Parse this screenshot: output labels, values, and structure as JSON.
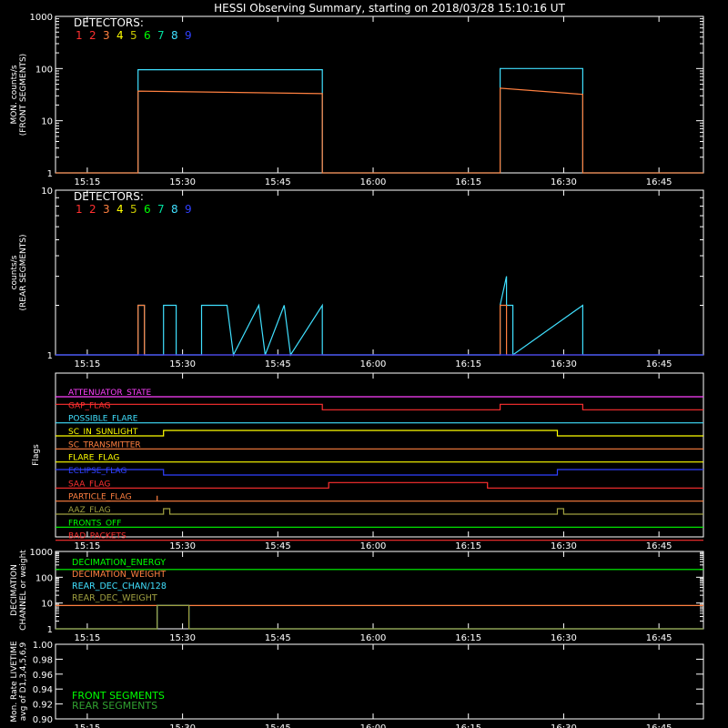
{
  "title": "HESSI Observing Summary, starting on 2018/03/28 15:10:16 UT",
  "time_ticks": [
    "15:15",
    "15:30",
    "15:45",
    "16:00",
    "16:15",
    "16:30",
    "16:45"
  ],
  "detectors": {
    "label": "DETECTORS:",
    "numbers": [
      "1",
      "2",
      "3",
      "4",
      "5",
      "6",
      "7",
      "8",
      "9"
    ],
    "colors": [
      "#ff3030",
      "#ff3030",
      "#ff8040",
      "#ffff00",
      "#c8c800",
      "#00ff00",
      "#00e0a0",
      "#40e0ff",
      "#3040ff"
    ]
  },
  "chart_data": [
    {
      "type": "line",
      "name": "front-panel",
      "ylabel": "MON. counts/s\n(FRONT SEGMENTS)",
      "yscale": "log",
      "ylim": [
        1,
        1000
      ],
      "y_ticks": [
        "1",
        "10",
        "100",
        "1000"
      ],
      "xlim": [
        "15:10",
        "16:52"
      ],
      "series": [
        {
          "color": "#40e0ff",
          "x": [
            "15:10",
            "15:23",
            "15:23",
            "15:52",
            "15:52",
            "16:20",
            "16:20",
            "16:33",
            "16:33",
            "16:52"
          ],
          "y": [
            1,
            1,
            95,
            95,
            1,
            1,
            100,
            100,
            1,
            1
          ]
        },
        {
          "color": "#ff8040",
          "x": [
            "15:10",
            "15:23",
            "15:23",
            "15:52",
            "15:52",
            "16:20",
            "16:20",
            "16:33",
            "16:33",
            "16:52"
          ],
          "y": [
            1,
            1,
            37,
            33,
            1,
            1,
            42,
            32,
            1,
            1
          ]
        }
      ]
    },
    {
      "type": "line",
      "name": "rear-panel",
      "ylabel": "counts/s\n(REAR SEGMENTS)",
      "yscale": "log",
      "ylim": [
        1,
        10
      ],
      "y_ticks": [
        "1",
        "10"
      ],
      "xlim": [
        "15:10",
        "16:52"
      ],
      "series": [
        {
          "color": "#40e0ff",
          "x": [
            "15:10",
            "15:23",
            "15:23",
            "15:24",
            "15:24",
            "15:27",
            "15:27",
            "15:29",
            "15:29",
            "15:33",
            "15:33",
            "15:37",
            "15:38",
            "15:42",
            "15:43",
            "15:46",
            "15:47",
            "15:52",
            "15:52",
            "16:20",
            "16:20",
            "16:21",
            "16:21",
            "16:22",
            "16:22",
            "16:33",
            "16:33",
            "16:52"
          ],
          "y": [
            1,
            1,
            2,
            2,
            1,
            1,
            2,
            2,
            1,
            1,
            2,
            2,
            1,
            2,
            1,
            2,
            1,
            2,
            1,
            1,
            2,
            3,
            2,
            2,
            1,
            2,
            1,
            1
          ]
        },
        {
          "color": "#ff8040",
          "x": [
            "15:10",
            "15:23",
            "15:23",
            "15:24",
            "15:24",
            "16:20",
            "16:20",
            "16:21",
            "16:21",
            "16:52"
          ],
          "y": [
            1,
            1,
            2,
            2,
            1,
            1,
            2,
            2,
            1,
            1
          ]
        },
        {
          "color": "#3040ff",
          "x": [
            "15:10",
            "16:52"
          ],
          "y": [
            1,
            1
          ]
        }
      ]
    },
    {
      "type": "line",
      "name": "flags-panel",
      "ylabel": "Flags",
      "xlim": [
        "15:10",
        "16:52"
      ],
      "flags": [
        {
          "label": "ATTENUATOR_STATE",
          "color": "#ff40ff",
          "x": [
            "15:10",
            "16:52"
          ],
          "y": [
            0,
            0
          ]
        },
        {
          "label": "GAP_FLAG",
          "color": "#ff3030",
          "x": [
            "15:10",
            "15:52",
            "15:52",
            "16:20",
            "16:20",
            "16:33",
            "16:33",
            "16:52"
          ],
          "y": [
            1,
            1,
            0,
            0,
            1,
            1,
            0,
            0
          ]
        },
        {
          "label": "POSSIBLE_FLARE",
          "color": "#40e0ff",
          "x": [
            "15:10",
            "16:52"
          ],
          "y": [
            0,
            0
          ]
        },
        {
          "label": "SC_IN_SUNLIGHT",
          "color": "#ffff00",
          "x": [
            "15:10",
            "15:27",
            "15:27",
            "16:29",
            "16:29",
            "16:52"
          ],
          "y": [
            0,
            0,
            1,
            1,
            0,
            0
          ]
        },
        {
          "label": "SC_TRANSMITTER",
          "color": "#ff8040",
          "x": [
            "15:10",
            "16:52"
          ],
          "y": [
            0,
            0
          ]
        },
        {
          "label": "FLARE_FLAG",
          "color": "#ffff00",
          "x": [
            "15:10",
            "16:52"
          ],
          "y": [
            0,
            0
          ]
        },
        {
          "label": "ECLIPSE_FLAG",
          "color": "#3040ff",
          "x": [
            "15:10",
            "15:27",
            "15:27",
            "16:29",
            "16:29",
            "16:52"
          ],
          "y": [
            1,
            1,
            0,
            0,
            1,
            1
          ]
        },
        {
          "label": "SAA_FLAG",
          "color": "#ff3030",
          "x": [
            "15:10",
            "15:53",
            "15:53",
            "16:18",
            "16:18",
            "16:52"
          ],
          "y": [
            0,
            0,
            1,
            1,
            0,
            0
          ]
        },
        {
          "label": "PARTICLE_FLAG",
          "color": "#ff8040",
          "x": [
            "15:10",
            "15:26",
            "15:26",
            "15:26",
            "15:26",
            "16:52"
          ],
          "y": [
            0,
            0,
            1,
            1,
            0,
            0
          ]
        },
        {
          "label": "AAZ_FLAG",
          "color": "#a0a040",
          "x": [
            "15:10",
            "15:27",
            "15:27",
            "15:28",
            "15:28",
            "16:29",
            "16:29",
            "16:30",
            "16:30",
            "16:52"
          ],
          "y": [
            0,
            0,
            1,
            1,
            0,
            0,
            1,
            1,
            0,
            0
          ]
        },
        {
          "label": "FRONTS_OFF",
          "color": "#00ff00",
          "x": [
            "15:10",
            "16:52"
          ],
          "y": [
            0,
            0
          ]
        },
        {
          "label": "BAD_PACKETS",
          "color": "#ff3030",
          "x": [
            "15:10",
            "16:52"
          ],
          "y": [
            0,
            0
          ]
        }
      ]
    },
    {
      "type": "line",
      "name": "decimation-panel",
      "ylabel": "DECIMATION\nCHANNEL or weight",
      "yscale": "log",
      "ylim": [
        1,
        1000
      ],
      "y_ticks": [
        "1",
        "10",
        "100",
        "1000"
      ],
      "xlim": [
        "15:10",
        "16:52"
      ],
      "series": [
        {
          "label": "DECIMATION_ENERGY",
          "color": "#00ff00",
          "x": [
            "15:10",
            "16:52"
          ],
          "y": [
            200,
            200
          ]
        },
        {
          "label": "DECIMATION_WEIGHT",
          "color": "#ff8040",
          "x": [
            "15:10",
            "16:52"
          ],
          "y": [
            8,
            8
          ]
        },
        {
          "label": "REAR_DEC_CHAN/128",
          "color": "#40e0ff",
          "x": [
            "15:10",
            "15:26",
            "15:26",
            "15:31",
            "15:31",
            "16:52"
          ],
          "y": [
            1,
            1,
            8,
            8,
            1,
            1
          ]
        },
        {
          "label": "REAR_DEC_WEIGHT",
          "color": "#a0a040",
          "x": [
            "15:10",
            "15:26",
            "15:26",
            "15:31",
            "15:31",
            "16:52"
          ],
          "y": [
            1,
            1,
            8,
            8,
            1,
            1
          ]
        }
      ]
    },
    {
      "type": "line",
      "name": "livetime-panel",
      "ylabel": "Mon. Rate LIVETIME\navg of D1,3,4,5,6,9",
      "ylim": [
        0.9,
        1.0
      ],
      "y_ticks": [
        "0.90",
        "0.92",
        "0.94",
        "0.96",
        "0.98",
        "1.00"
      ],
      "xlim": [
        "15:10",
        "16:52"
      ],
      "legend": [
        {
          "label": "FRONT SEGMENTS",
          "color": "#00ff00"
        },
        {
          "label": "REAR SEGMENTS",
          "color": "#30a030"
        }
      ],
      "series": []
    }
  ]
}
